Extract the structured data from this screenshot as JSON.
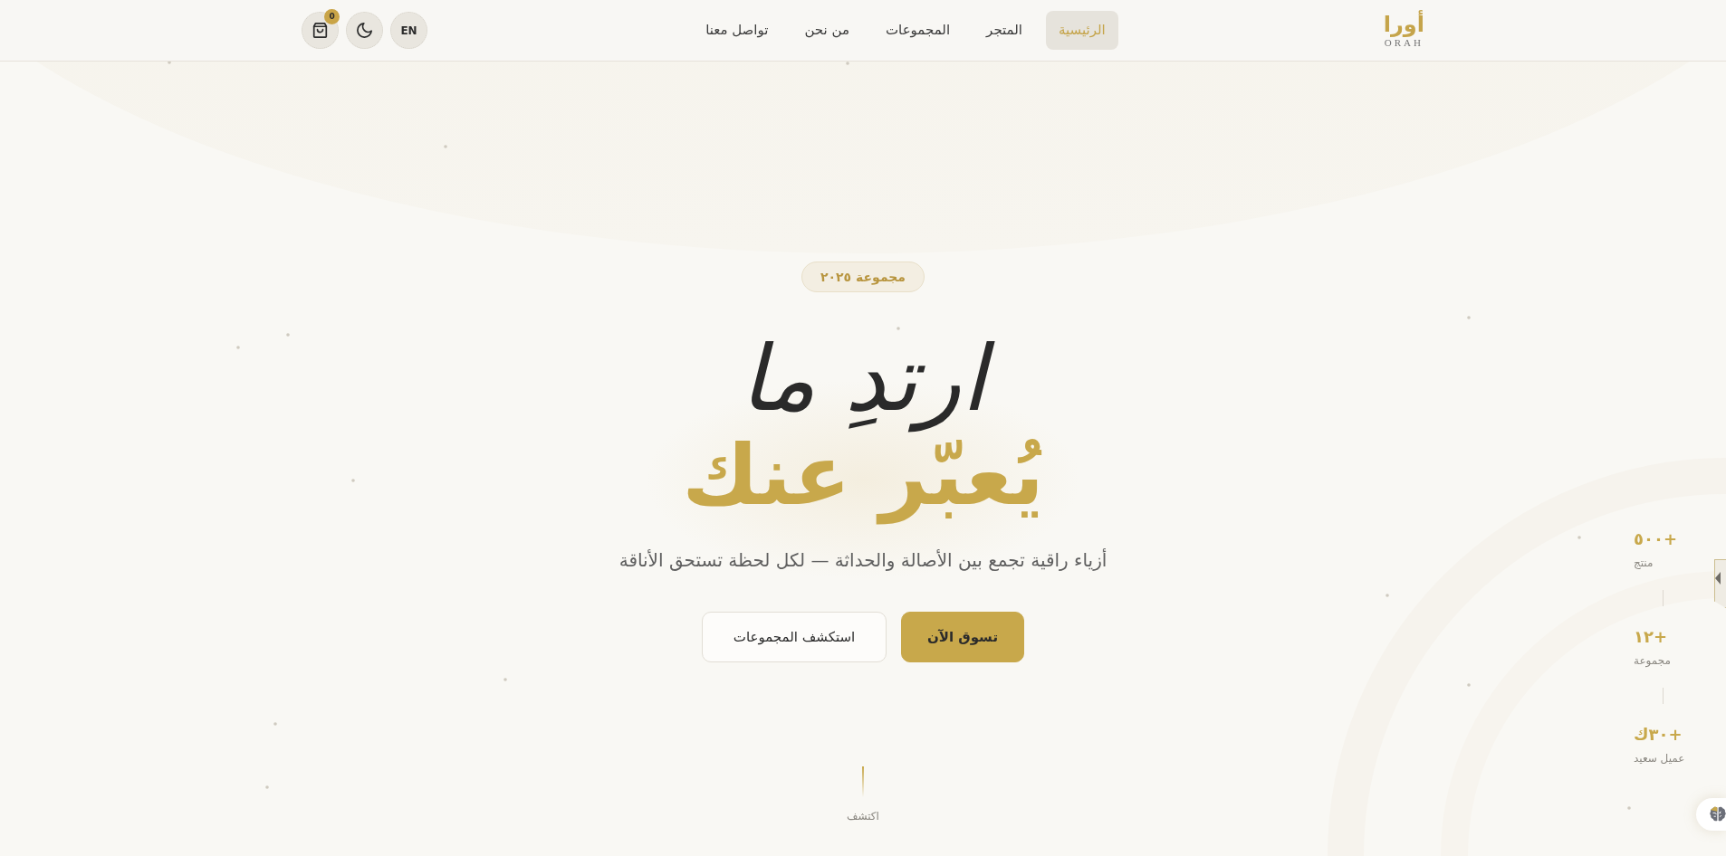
{
  "brand": {
    "name": "أورا",
    "latin": "ORAH"
  },
  "nav": {
    "items": [
      {
        "label": "الرئيسية",
        "selected": true
      },
      {
        "label": "المتجر",
        "selected": false
      },
      {
        "label": "المجموعات",
        "selected": false
      },
      {
        "label": "من نحن",
        "selected": false
      },
      {
        "label": "تواصل معنا",
        "selected": false
      }
    ]
  },
  "actions": {
    "language": "EN",
    "cart_count": "0"
  },
  "hero": {
    "badge": "مجموعة ٢٠٢٥",
    "title_line_1": "ارتدِ ما",
    "title_line_2": "يُعبّر عنك",
    "subtitle": "أزياء راقية تجمع بين الأصالة والحداثة — لكل لحظة تستحق الأناقة",
    "buttons": [
      {
        "label": "تسوق الآن",
        "kind": "primary"
      },
      {
        "label": "استكشف المجموعات",
        "kind": "outline"
      }
    ],
    "scroll_hint": "اكتشف"
  },
  "stats": [
    {
      "value": "+٥٠٠",
      "label": "منتج"
    },
    {
      "value": "+١٢",
      "label": "مجموعة"
    },
    {
      "value": "+٣٠ك",
      "label": "عميل سعيد"
    }
  ]
}
